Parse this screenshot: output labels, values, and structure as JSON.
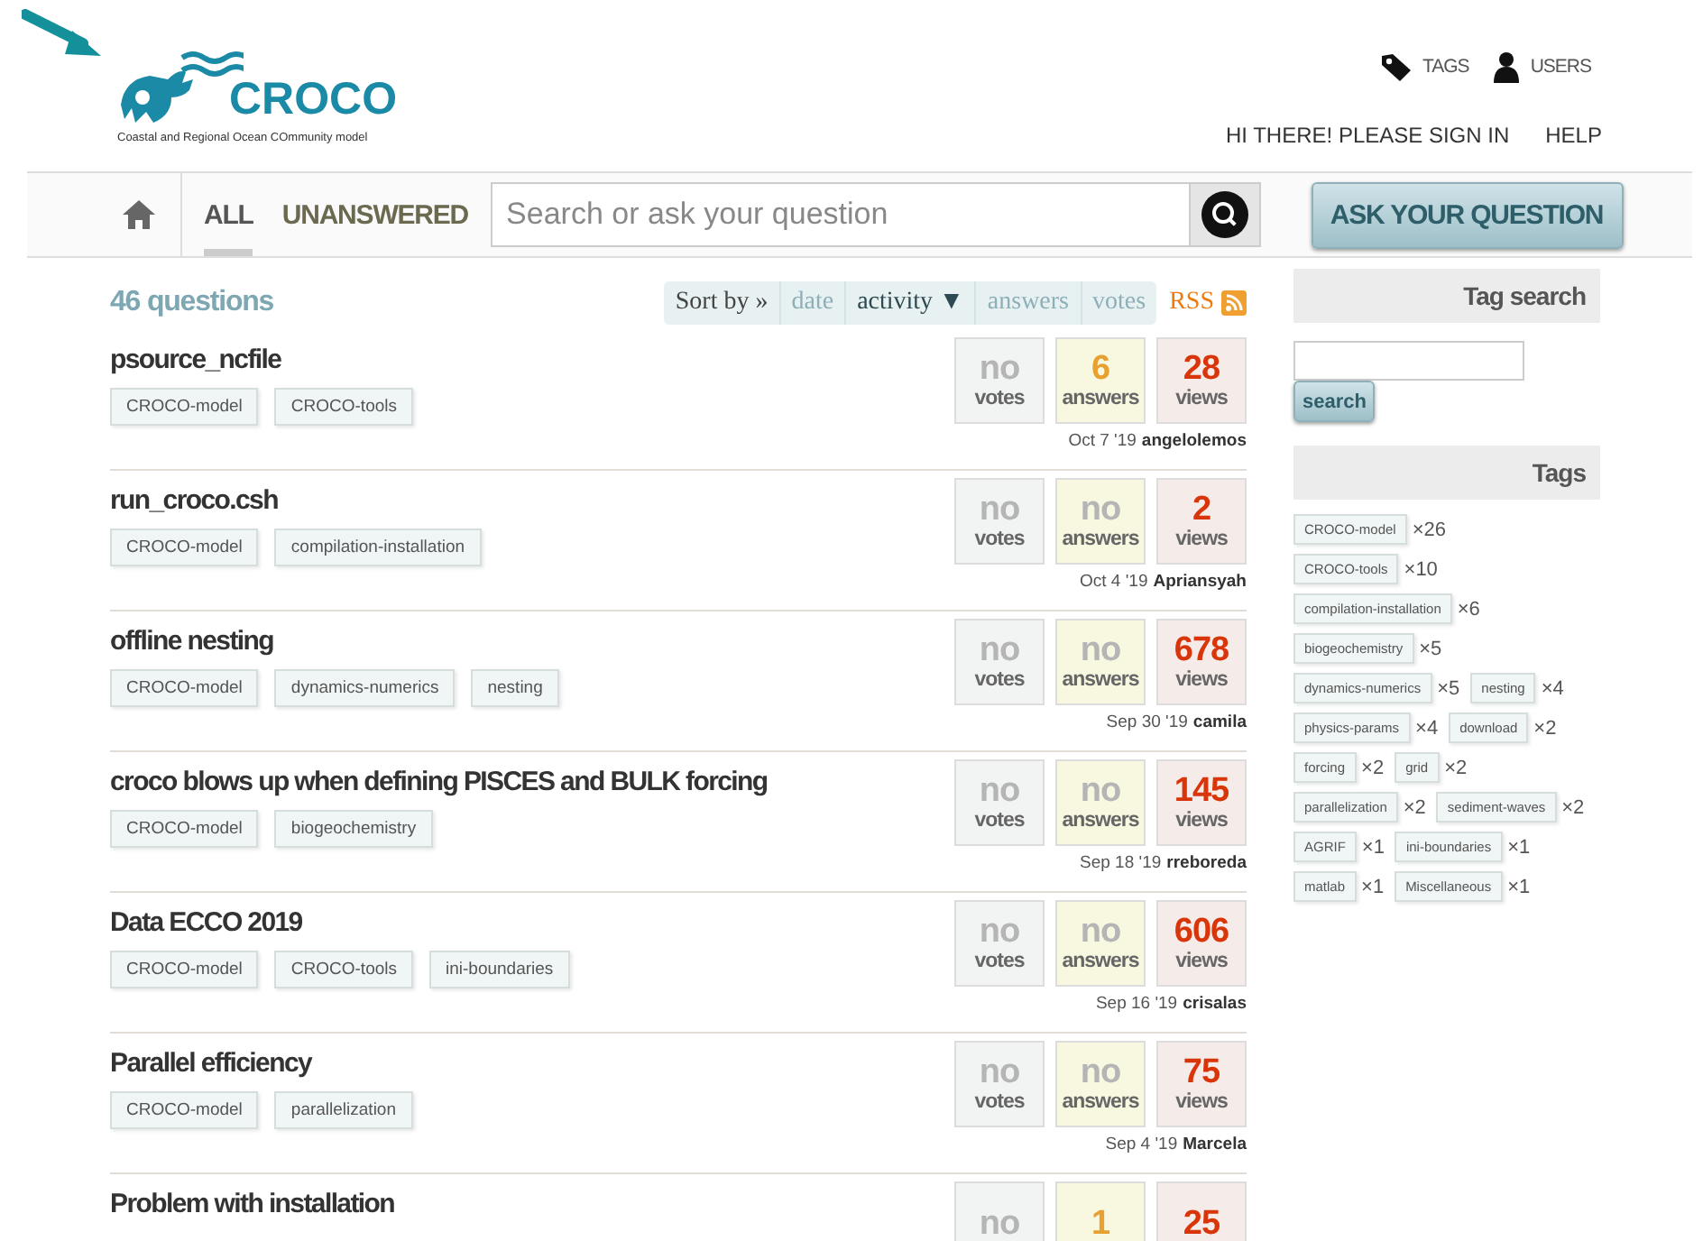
{
  "logo": {
    "name": "CROCO",
    "tagline": "Coastal and Regional Ocean COmmunity model"
  },
  "top_links": [
    {
      "kind": "tag",
      "label": "TAGS"
    },
    {
      "kind": "user",
      "label": "USERS"
    }
  ],
  "user_links": [
    "HI THERE! PLEASE SIGN IN",
    "HELP"
  ],
  "nav_tabs": [
    {
      "label": "ALL",
      "selected": true
    },
    {
      "label": "UNANSWERED",
      "selected": false
    }
  ],
  "search": {
    "placeholder": "Search or ask your question"
  },
  "ask_button": "ASK YOUR QUESTION",
  "question_count": "46 questions",
  "sort": {
    "label": "Sort by »",
    "options": [
      {
        "label": "date",
        "selected": false
      },
      {
        "label": "activity ▼",
        "selected": true
      },
      {
        "label": "answers",
        "selected": false
      },
      {
        "label": "votes",
        "selected": false
      }
    ]
  },
  "rss": "RSS",
  "questions": [
    {
      "title": "psource_ncfile",
      "tags": [
        "CROCO-model",
        "CROCO-tools"
      ],
      "stats": [
        {
          "kind": "votes",
          "value": "no",
          "label": "votes",
          "empty": true
        },
        {
          "kind": "answers",
          "value": "6",
          "label": "answers",
          "empty": false
        },
        {
          "kind": "views",
          "value": "28",
          "label": "views",
          "empty": false
        }
      ],
      "date": "Oct 7 '19",
      "author": "angelolemos"
    },
    {
      "title": "run_croco.csh",
      "tags": [
        "CROCO-model",
        "compilation-installation"
      ],
      "stats": [
        {
          "kind": "votes",
          "value": "no",
          "label": "votes",
          "empty": true
        },
        {
          "kind": "answers",
          "value": "no",
          "label": "answers",
          "empty": true
        },
        {
          "kind": "views",
          "value": "2",
          "label": "views",
          "empty": false
        }
      ],
      "date": "Oct 4 '19",
      "author": "Apriansyah"
    },
    {
      "title": "offline nesting",
      "tags": [
        "CROCO-model",
        "dynamics-numerics",
        "nesting"
      ],
      "stats": [
        {
          "kind": "votes",
          "value": "no",
          "label": "votes",
          "empty": true
        },
        {
          "kind": "answers",
          "value": "no",
          "label": "answers",
          "empty": true
        },
        {
          "kind": "views",
          "value": "678",
          "label": "views",
          "empty": false
        }
      ],
      "date": "Sep 30 '19",
      "author": "camila"
    },
    {
      "title": "croco blows up when defining PISCES and BULK forcing",
      "tags": [
        "CROCO-model",
        "biogeochemistry"
      ],
      "stats": [
        {
          "kind": "votes",
          "value": "no",
          "label": "votes",
          "empty": true
        },
        {
          "kind": "answers",
          "value": "no",
          "label": "answers",
          "empty": true
        },
        {
          "kind": "views",
          "value": "145",
          "label": "views",
          "empty": false
        }
      ],
      "date": "Sep 18 '19",
      "author": "rreboreda"
    },
    {
      "title": "Data ECCO 2019",
      "tags": [
        "CROCO-model",
        "CROCO-tools",
        "ini-boundaries"
      ],
      "stats": [
        {
          "kind": "votes",
          "value": "no",
          "label": "votes",
          "empty": true
        },
        {
          "kind": "answers",
          "value": "no",
          "label": "answers",
          "empty": true
        },
        {
          "kind": "views",
          "value": "606",
          "label": "views",
          "empty": false
        }
      ],
      "date": "Sep 16 '19",
      "author": "crisalas"
    },
    {
      "title": "Parallel efficiency",
      "tags": [
        "CROCO-model",
        "parallelization"
      ],
      "stats": [
        {
          "kind": "votes",
          "value": "no",
          "label": "votes",
          "empty": true
        },
        {
          "kind": "answers",
          "value": "no",
          "label": "answers",
          "empty": true
        },
        {
          "kind": "views",
          "value": "75",
          "label": "views",
          "empty": false
        }
      ],
      "date": "Sep 4 '19",
      "author": "Marcela"
    },
    {
      "title": "Problem with installation",
      "stats": [
        {
          "kind": "votes",
          "value": "no",
          "empty": true
        },
        {
          "kind": "answers",
          "value": "1",
          "empty": false
        },
        {
          "kind": "views",
          "value": "25",
          "empty": false
        }
      ]
    }
  ],
  "tag_search": {
    "title": "Tag search",
    "button": "search"
  },
  "tags_panel": {
    "title": "Tags",
    "tags": [
      {
        "name": "CROCO-model",
        "count": "×26"
      },
      {
        "name": "CROCO-tools",
        "count": "×10"
      },
      {
        "name": "compilation-installation",
        "count": "×6"
      },
      {
        "name": "biogeochemistry",
        "count": "×5"
      },
      {
        "name": "dynamics-numerics",
        "count": "×5"
      },
      {
        "name": "nesting",
        "count": "×4"
      },
      {
        "name": "physics-params",
        "count": "×4"
      },
      {
        "name": "download",
        "count": "×2"
      },
      {
        "name": "forcing",
        "count": "×2"
      },
      {
        "name": "grid",
        "count": "×2"
      },
      {
        "name": "parallelization",
        "count": "×2"
      },
      {
        "name": "sediment-waves",
        "count": "×2"
      },
      {
        "name": "AGRIF",
        "count": "×1"
      },
      {
        "name": "ini-boundaries",
        "count": "×1"
      },
      {
        "name": "matlab",
        "count": "×1"
      },
      {
        "name": "Miscellaneous",
        "count": "×1"
      }
    ]
  }
}
